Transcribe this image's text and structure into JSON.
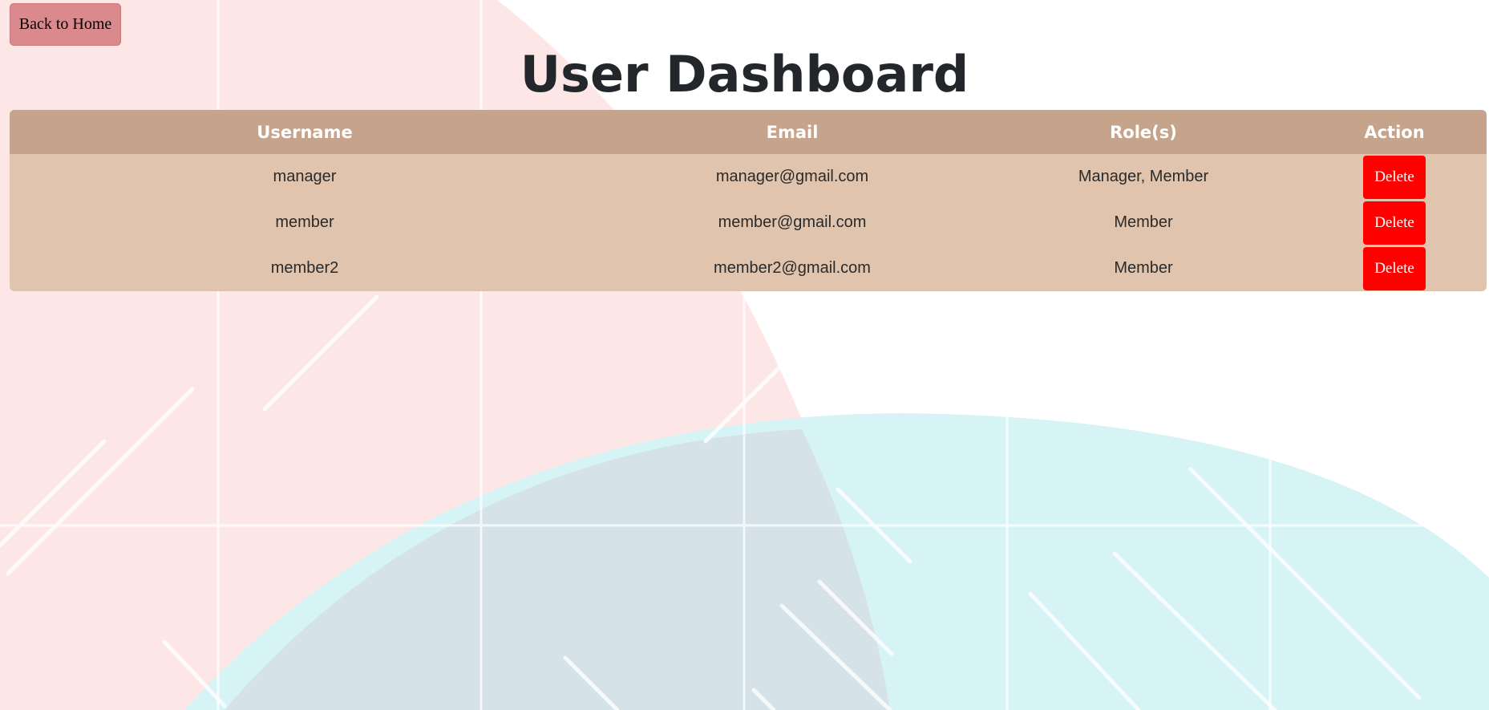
{
  "nav": {
    "back_label": "Back to Home"
  },
  "page": {
    "title": "User Dashboard"
  },
  "table": {
    "headers": [
      "Username",
      "Email",
      "Role(s)",
      "Action"
    ],
    "rows": [
      {
        "username": "manager",
        "email": "manager@gmail.com",
        "roles": "Manager, Member",
        "action": "Delete"
      },
      {
        "username": "member",
        "email": "member@gmail.com",
        "roles": "Member",
        "action": "Delete"
      },
      {
        "username": "member2",
        "email": "member2@gmail.com",
        "roles": "Member",
        "action": "Delete"
      }
    ]
  },
  "colors": {
    "header_bg": "#c6a48b",
    "row_bg": "#e0c4ad",
    "delete_button": "#ff0000",
    "back_button": "#da8a8c"
  }
}
